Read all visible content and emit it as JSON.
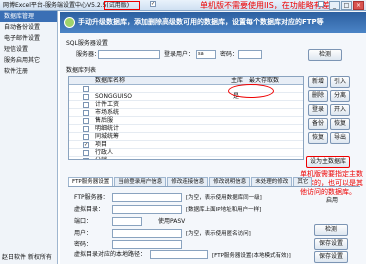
{
  "window": {
    "title": "网博Excel平台-服务端设置中心V5.2.5(试用版)",
    "note": "单机版不需要使用IIS，在功能略有差别",
    "buttons": [
      "_",
      "□",
      "×"
    ]
  },
  "sidebar": {
    "items": [
      "数据库管理",
      "自动备份设置",
      "电子邮件设置",
      "短信设置",
      "服务启用其它",
      "软件注册"
    ],
    "footer": "赵日软件  新权所有"
  },
  "banner": {
    "text": "手动升级数据库，添加删除高级数可用的数据库，设置每个数据库对应的FTP等"
  },
  "sql": {
    "group_label": "SQL服务器设置",
    "server_label": "服务器：",
    "login_label": "登录用户：",
    "login_value": "sa",
    "password_label": "密码：",
    "check_button": "检测"
  },
  "list": {
    "group_label": "数据库列表",
    "columns": [
      "数据库名称",
      "主库",
      "最大存取数"
    ],
    "rows": [
      {
        "name": "",
        "main": "",
        "max": "",
        "checked": false
      },
      {
        "name": "SONGGUISO",
        "main": "是",
        "max": "",
        "checked": false
      },
      {
        "name": "计件工资",
        "main": "",
        "max": "",
        "checked": false
      },
      {
        "name": "市场系统",
        "main": "",
        "max": "",
        "checked": false
      },
      {
        "name": "售后服",
        "main": "",
        "max": "",
        "checked": false
      },
      {
        "name": "明细统计",
        "main": "",
        "max": "",
        "checked": false
      },
      {
        "name": "同城统筹",
        "main": "",
        "max": "",
        "checked": false
      },
      {
        "name": "项目",
        "main": "",
        "max": "",
        "checked": true
      },
      {
        "name": "行政人",
        "main": "",
        "max": "",
        "checked": false
      },
      {
        "name": "分销",
        "main": "",
        "max": "",
        "checked": true
      }
    ],
    "side_buttons": [
      "新增",
      "引入",
      "删除",
      "分离",
      "登录",
      "开入",
      "备份",
      "恢复",
      "恢复",
      "导出"
    ],
    "set_main_button": "设为主数据库",
    "annotation": "单机版需要指定主数据库的，也可以是其他访问的数据库。"
  },
  "tabs": [
    "FTP服务器设置",
    "当前登录用户信息",
    "修改连接信息",
    "修改说明信息",
    "未处理的修改",
    "其它"
  ],
  "ftp": {
    "server_label": "FTP服务器：",
    "dir_label": "虚拟目录：",
    "port_label": "端口：",
    "passive_label": "使用PASV",
    "passive_checked": true,
    "user_label": "用户：",
    "password_label": "密码：",
    "local_label": "虚拟目录对应的本地路径：",
    "hint1": "[为空，表示使用数据库同一级]",
    "hint2": "[数据库上面IP地址和用户一样]",
    "hint3": "[为空，表示使用匿名访问]",
    "hint4": "[FTP服务器设置(本地模式有效)]",
    "enable_label": "启用",
    "buttons": [
      "检测",
      "保存设置",
      "保存设置"
    ]
  }
}
